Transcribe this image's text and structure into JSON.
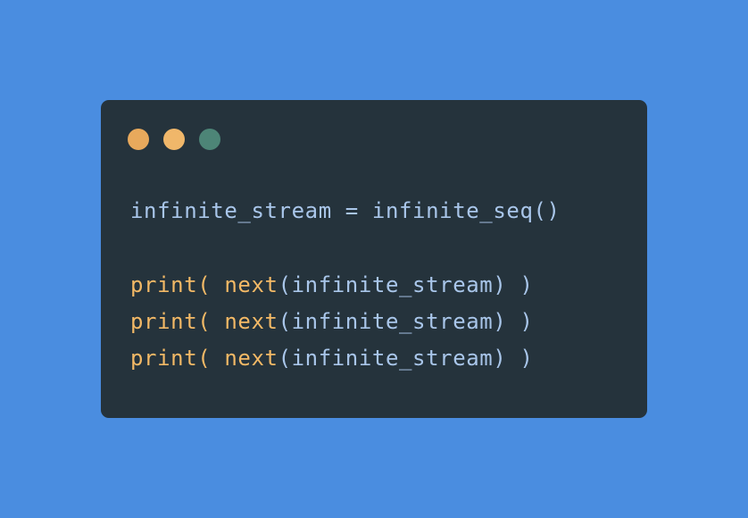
{
  "colors": {
    "background": "#4a8de0",
    "window": "#25333c",
    "dot_1": "#e8a95c",
    "dot_2": "#f0b76a",
    "dot_3": "#4d8577",
    "identifier": "#a9c6ea",
    "keyword": "#f3b966"
  },
  "window_controls": [
    "dot-1",
    "dot-2",
    "dot-3"
  ],
  "code": {
    "line1": {
      "var": "infinite_stream",
      "op": " = ",
      "call": "infinite_seq()"
    },
    "lines": [
      {
        "fn": "print",
        "open": "( ",
        "inner_fn": "next",
        "args": "(infinite_stream)",
        "close": " )"
      },
      {
        "fn": "print",
        "open": "( ",
        "inner_fn": "next",
        "args": "(infinite_stream)",
        "close": " )"
      },
      {
        "fn": "print",
        "open": "( ",
        "inner_fn": "next",
        "args": "(infinite_stream)",
        "close": " )"
      }
    ]
  }
}
